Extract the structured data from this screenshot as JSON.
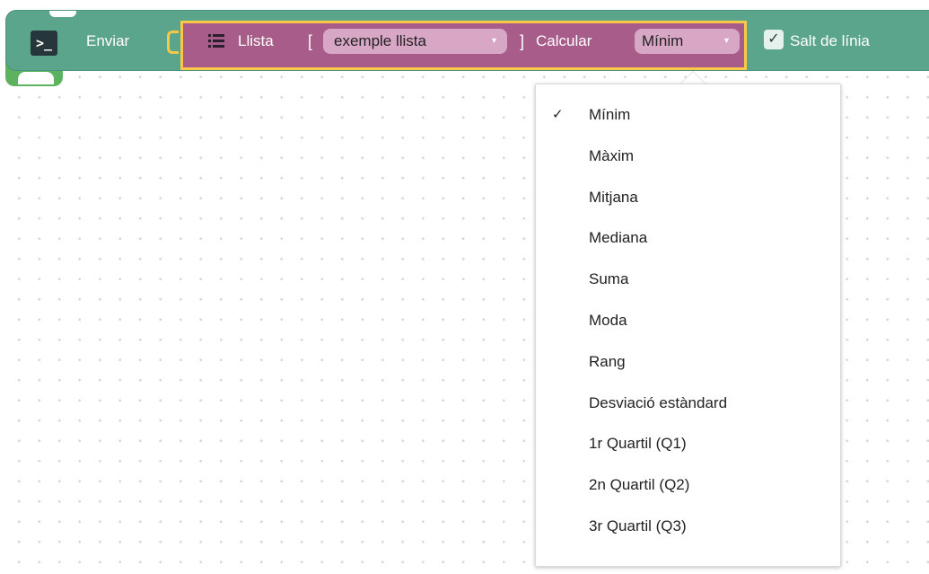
{
  "block": {
    "terminal_icon_glyph": ">_",
    "enviar_label": "Enviar",
    "llista_label": "Llista",
    "open_bracket": "[",
    "list_variable": "exemple llista",
    "close_bracket": "]",
    "calcular_label": "Calcular",
    "operation_selected": "Mínim",
    "dropdown_caret": "▾",
    "linebreak_checked_glyph": "✓",
    "linebreak_label": "Salt de línia"
  },
  "menu": {
    "check_glyph": "✓",
    "selected_index": 0,
    "items": [
      {
        "label": "Mínim"
      },
      {
        "label": "Màxim"
      },
      {
        "label": "Mitjana"
      },
      {
        "label": "Mediana"
      },
      {
        "label": "Suma"
      },
      {
        "label": "Moda"
      },
      {
        "label": "Rang"
      },
      {
        "label": "Desviació estàndard"
      },
      {
        "label": "1r Quartil (Q1)"
      },
      {
        "label": "2n Quartil (Q2)"
      },
      {
        "label": "3r Quartil (Q3)"
      }
    ]
  },
  "colors": {
    "outer_block": "#5ba58c",
    "inner_block": "#a85c8a",
    "highlight_border": "#f9c846",
    "dropdown_field": "#d9a7c6"
  },
  "icons": {
    "terminal": "terminal-icon",
    "list": "list-icon",
    "caret": "chevron-down-icon",
    "check": "checkmark-icon"
  }
}
